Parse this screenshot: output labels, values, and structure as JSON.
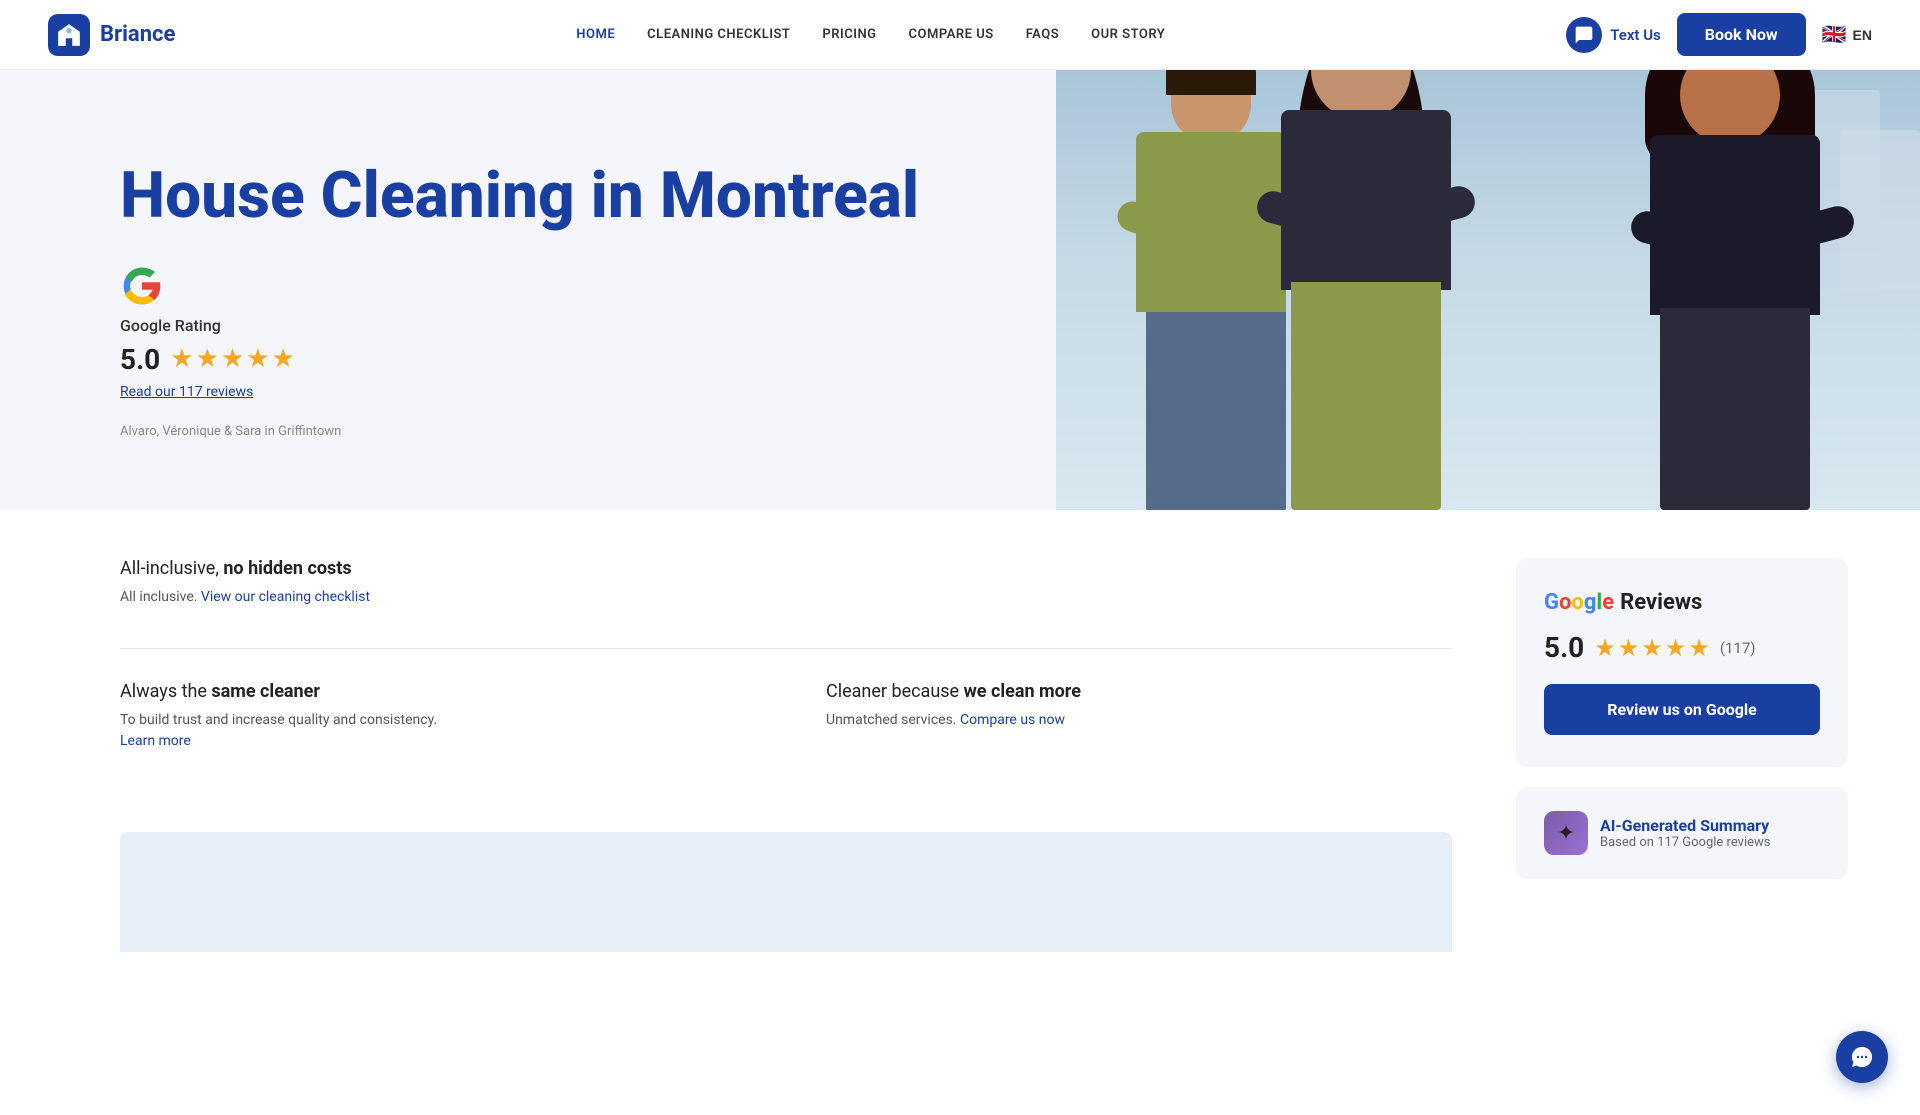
{
  "nav": {
    "logo_text": "Briance",
    "home_label": "HOME",
    "cleaning_checklist_label": "CLEANING CHECKLIST",
    "pricing_label": "PRICING",
    "compare_us_label": "COMPARE US",
    "faqs_label": "FAQS",
    "our_story_label": "OUR STORY",
    "text_us_label": "Text Us",
    "book_now_label": "Book Now",
    "lang_label": "EN"
  },
  "hero": {
    "title": "House Cleaning in Montreal",
    "google_rating_label": "Google Rating",
    "rating_value": "5.0",
    "reviews_link": "Read our 117 reviews",
    "caption": "Alvaro, Véronique & Sara in Griffintown"
  },
  "features": {
    "items": [
      {
        "title_plain": "All-inclusive, ",
        "title_bold": "no hidden costs",
        "desc_plain": "All inclusive. ",
        "desc_link": "View our cleaning checklist",
        "desc_after": ""
      },
      {
        "title_plain": "Always the ",
        "title_bold": "same cleaner",
        "desc_plain": "To build trust and increase quality and consistency.",
        "desc_link": "Learn more",
        "desc_after": ""
      },
      {
        "title_plain": "Cleaner because ",
        "title_bold": "we clean more",
        "desc_plain": "Unmatched services. ",
        "desc_link": "Compare us now",
        "desc_after": ""
      }
    ]
  },
  "google_reviews_card": {
    "google_text_1": "Google",
    "title": " Reviews",
    "score": "5.0",
    "count": "(117)",
    "button_label": "Review us on Google"
  },
  "ai_summary_card": {
    "title": "AI-Generated Summary",
    "subtitle": "Based on 117 Google reviews"
  }
}
